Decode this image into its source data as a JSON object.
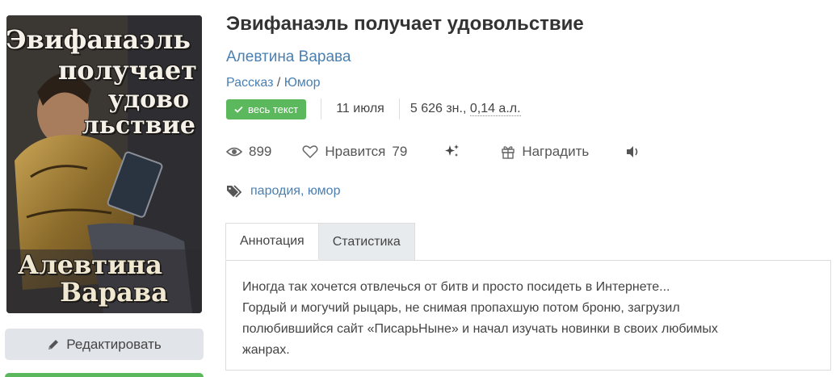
{
  "cover": {
    "title_lines": [
      "Эвифанаэль",
      "получает",
      "удово",
      "льствие"
    ],
    "author_lines": [
      "Алевтина",
      "Варава"
    ]
  },
  "edit_button": {
    "label": "Редактировать"
  },
  "book": {
    "title": "Эвифанаэль получает удовольствие",
    "author": "Алевтина Варава",
    "genre_1": "Рассказ",
    "genre_sep": " / ",
    "genre_2": "Юмор",
    "badge": "весь текст",
    "date": "11 июля",
    "size_chars": "5 626 зн., ",
    "size_al": "0,14 а.л."
  },
  "stats": {
    "views": "899",
    "likes_label": "Нравится",
    "likes": "79",
    "reward_label": "Наградить"
  },
  "tags": [
    "пародия",
    "юмор"
  ],
  "tags_sep": ",",
  "tabs": [
    "Аннотация",
    "Статистика"
  ],
  "annotation": [
    "Иногда так хочется отвлечься от битв и просто посидеть в Интернете...",
    "Гордый и могучий рыцарь, не снимая пропахшую потом броню, загрузил",
    "полюбившийся сайт «ПисарьНыне» и начал изучать новинки в своих любимых",
    "жанрах."
  ],
  "colors": {
    "link": "#4a7fb0",
    "badge": "#5cb85c",
    "tab_inactive": "#e8ebee"
  }
}
